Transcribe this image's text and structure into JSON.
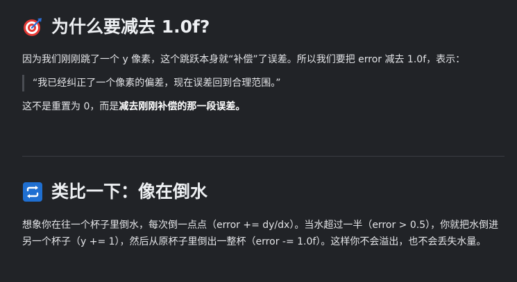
{
  "section1": {
    "icon": "direct-hit-target-icon",
    "heading": "为什么要减去 1.0f?",
    "para1": "因为我们刚刚跳了一个 y 像素，这个跳跃本身就“补偿”了误差。所以我们要把 error 减去 1.0f，表示：",
    "quote": "“我已经纠正了一个像素的偏差，现在误差回到合理范围。”",
    "para2_prefix": "这不是重置为 0，而是",
    "para2_bold": "减去刚刚补偿的那一段误差。"
  },
  "section2": {
    "icon": "repeat-arrows-icon",
    "heading": "类比一下：像在倒水",
    "para": "想象你在往一个杯子里倒水，每次倒一点点（error += dy/dx）。当水超过一半（error > 0.5），你就把水倒进另一个杯子（y += 1），然后从原杯子里倒出一整杯（error -= 1.0f）。这样你不会溢出，也不会丢失水量。"
  },
  "colors": {
    "background": "#212327",
    "text": "#e4e5e8",
    "quote_bar": "#4a4d53",
    "divider": "#3a3d43",
    "target_red": "#e53935",
    "repeat_blue": "#1f6fd1"
  }
}
